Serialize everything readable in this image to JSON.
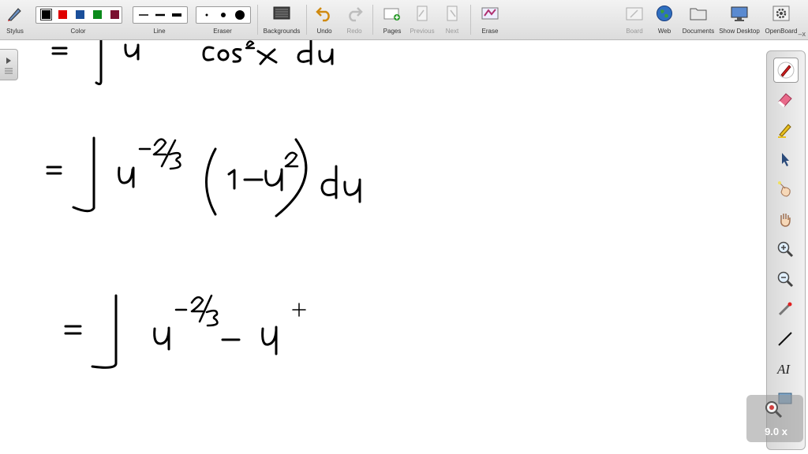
{
  "toolbar": {
    "stylus": "Stylus",
    "color": "Color",
    "line": "Line",
    "eraser": "Eraser",
    "backgrounds": "Backgrounds",
    "undo": "Undo",
    "redo": "Redo",
    "pages": "Pages",
    "previous": "Previous",
    "next": "Next",
    "erase": "Erase",
    "board": "Board",
    "web": "Web",
    "documents": "Documents",
    "show_desktop": "Show Desktop",
    "openboard": "OpenBoard",
    "colors": [
      "#000000",
      "#e00000",
      "#1a4f9a",
      "#0a8a1a",
      "#7a1030"
    ],
    "close_glyph": "–x"
  },
  "palette": {
    "text_tool": "AI",
    "active_color": "#d02020"
  },
  "zoom": {
    "value": "9.0 x"
  },
  "board": {
    "line1": [
      "=",
      "∫",
      "u",
      "cos",
      "2",
      "x",
      "du"
    ],
    "line2": [
      "=",
      "∫",
      "u",
      "−2/3",
      "(",
      "1",
      "−",
      "u",
      "2",
      ")",
      "du"
    ],
    "line3": [
      "=",
      "∫",
      "u",
      "−2/3",
      "−",
      "u",
      "+"
    ]
  }
}
